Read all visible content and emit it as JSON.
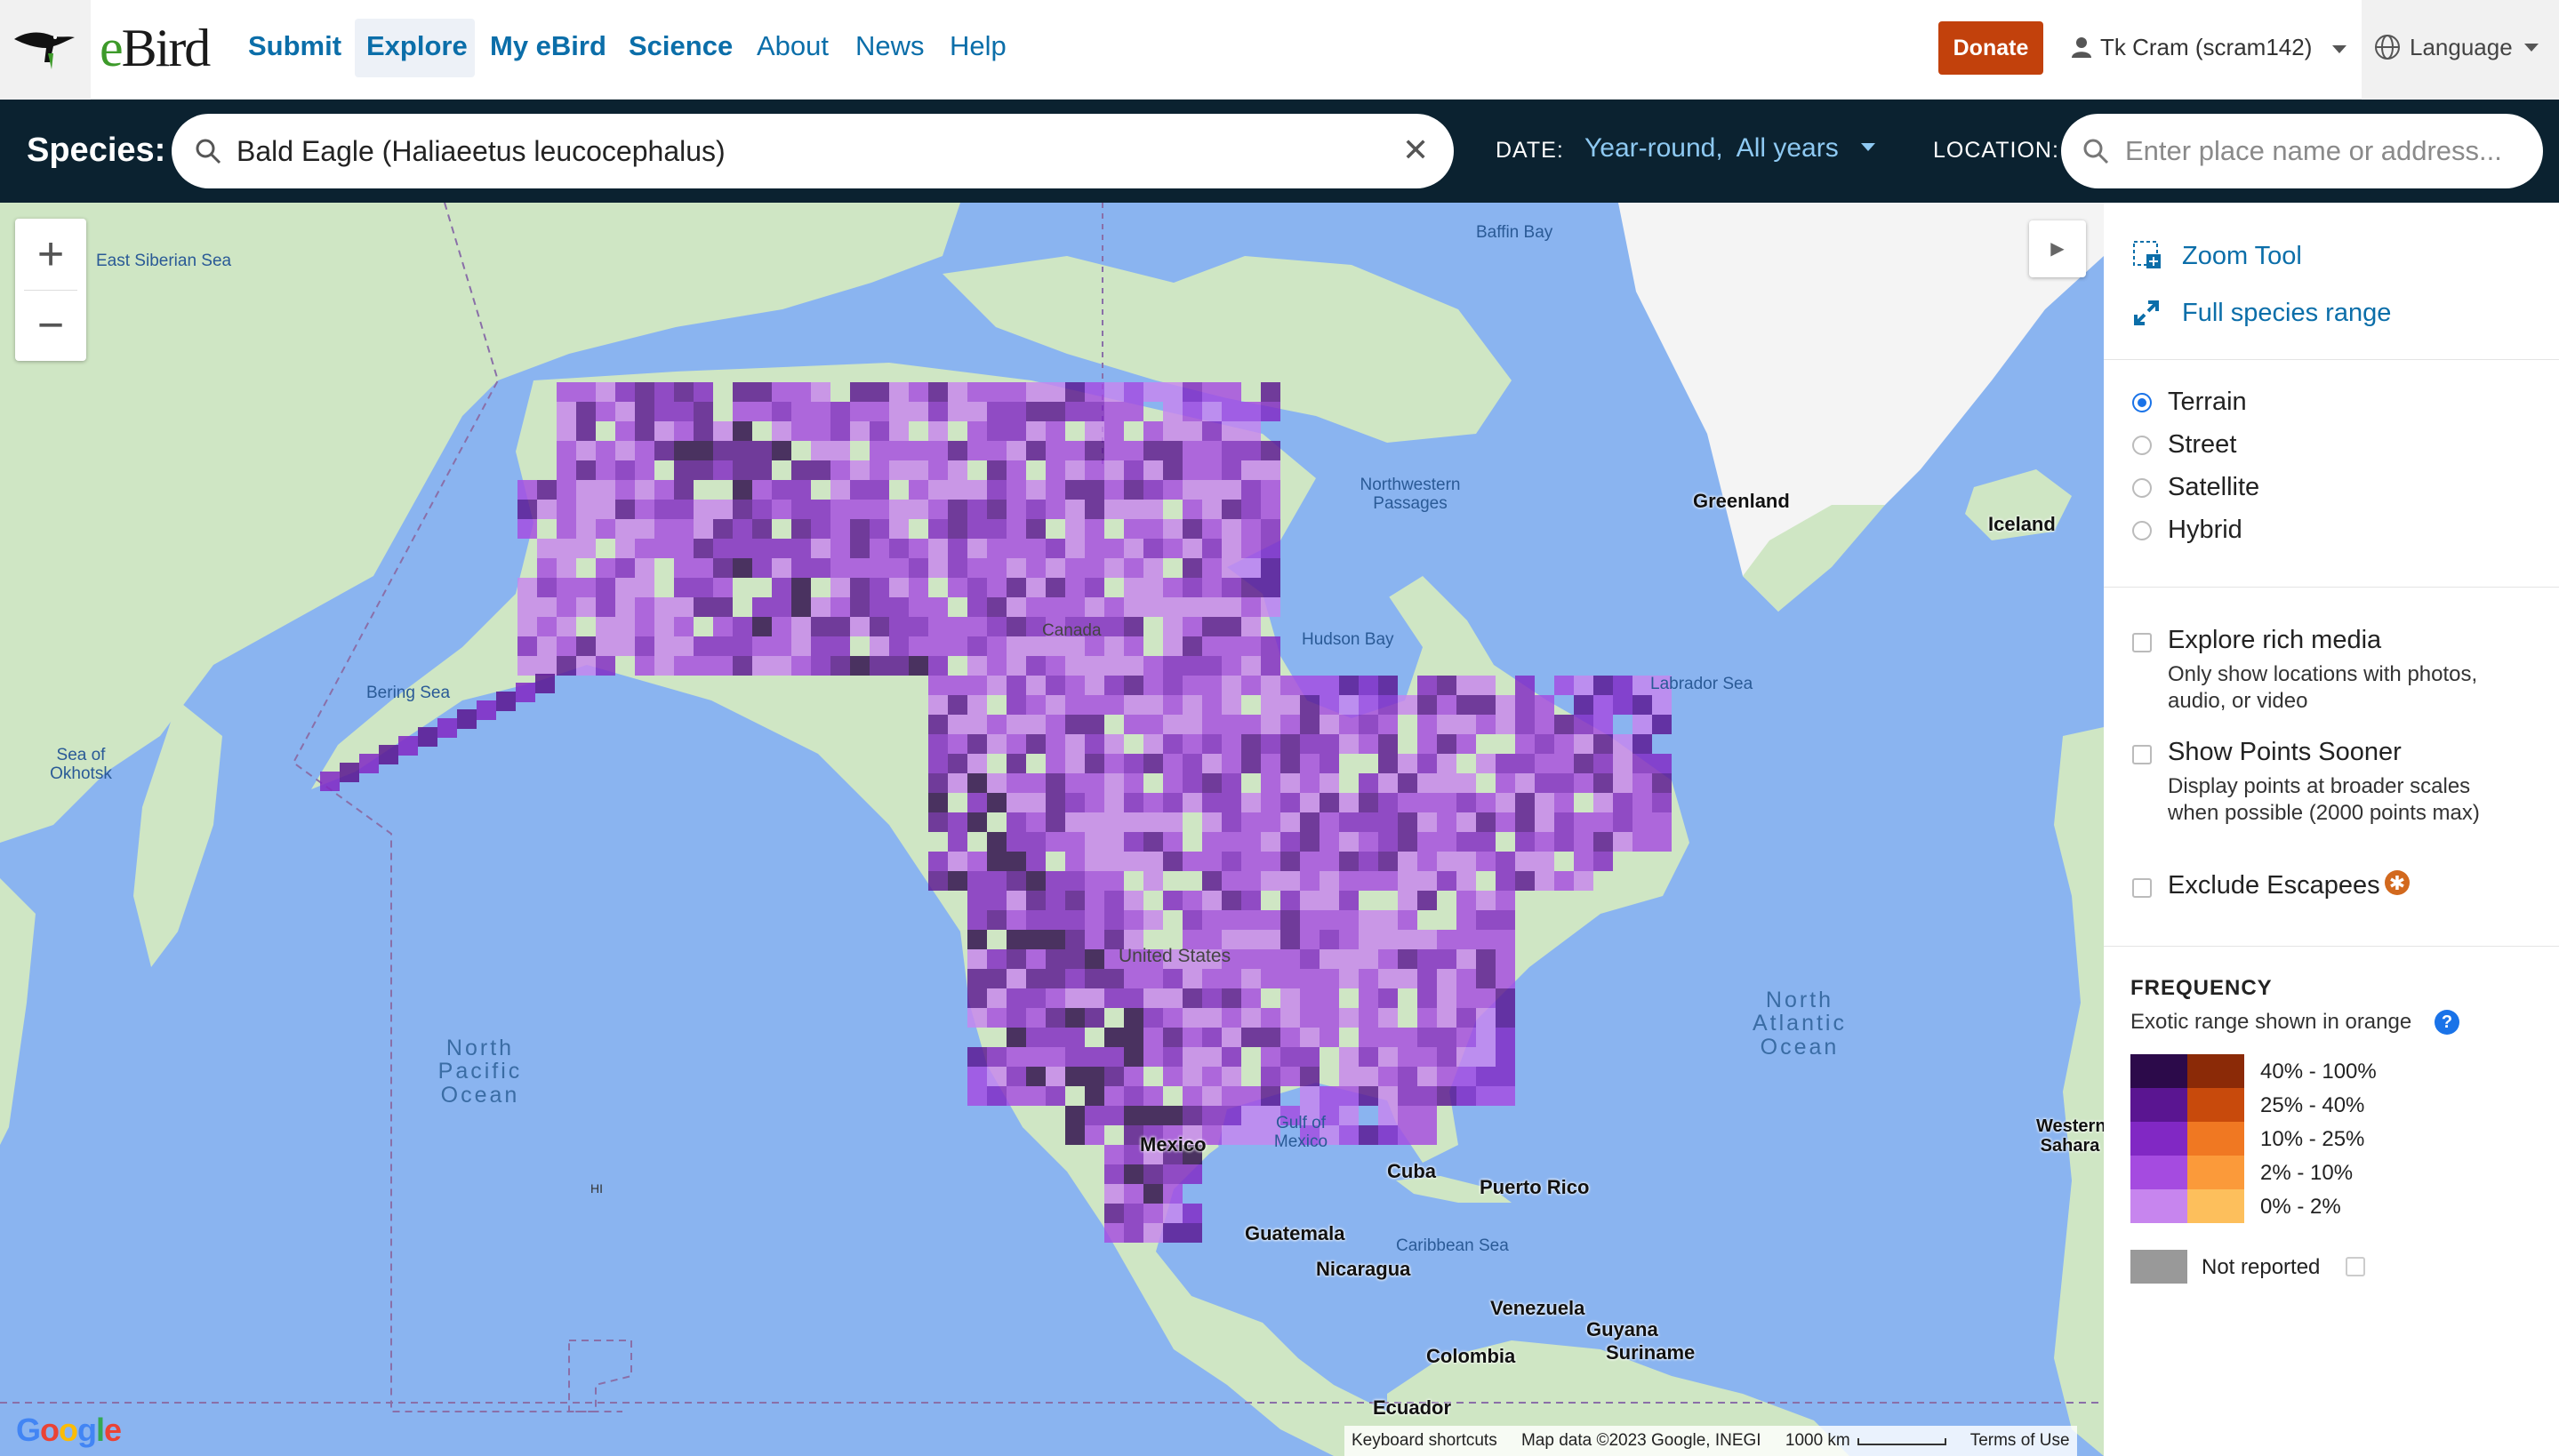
{
  "nav": {
    "brand": "eBird",
    "links": [
      "Submit",
      "Explore",
      "My eBird",
      "Science",
      "About",
      "News",
      "Help"
    ],
    "active": "Explore",
    "donate": "Donate",
    "user": "Tk Cram (scram142)",
    "language": "Language"
  },
  "search": {
    "species_label": "Species:",
    "species_value": "Bald Eagle (Haliaeetus leucocephalus)",
    "clear_icon": "close-icon",
    "date_label": "DATE:",
    "date_value": "Year-round,  All years",
    "location_label": "LOCATION:",
    "location_placeholder": "Enter place name or address..."
  },
  "map": {
    "labels": {
      "east_siberian_sea": "East Siberian Sea",
      "baffin_bay": "Baffin Bay",
      "northwestern_passages": "Northwestern Passages",
      "greenland": "Greenland",
      "iceland": "Iceland",
      "bering_sea": "Bering Sea",
      "sea_of_okhotsk": "Sea of Okhotsk",
      "hudson_bay": "Hudson Bay",
      "labrador_sea": "Labrador Sea",
      "canada": "Canada",
      "united_states": "United States",
      "north_pacific_ocean": "North Pacific Ocean",
      "north_atlantic_ocean": "North Atlantic Ocean",
      "gulf_of_mexico": "Gulf of Mexico",
      "mexico": "Mexico",
      "cuba": "Cuba",
      "puerto_rico": "Puerto Rico",
      "guatemala": "Guatemala",
      "nicaragua": "Nicaragua",
      "caribbean_sea": "Caribbean Sea",
      "venezuela": "Venezuela",
      "guyana": "Guyana",
      "suriname": "Suriname",
      "colombia": "Colombia",
      "ecuador": "Ecuador",
      "western_sahara": "Western Sahara",
      "hi": "HI"
    },
    "zoom_in": "+",
    "zoom_out": "−",
    "attribution": {
      "shortcuts": "Keyboard shortcuts",
      "map_data": "Map data ©2023 Google, INEGI",
      "scale": "1000 km",
      "terms": "Terms of Use"
    },
    "google": "Google",
    "colors": {
      "water": "#8ab4f0",
      "land": "#cfe6c4",
      "ice": "#f4f4f4"
    }
  },
  "panel": {
    "zoom_tool": "Zoom Tool",
    "full_range": "Full species range",
    "map_types": [
      "Terrain",
      "Street",
      "Satellite",
      "Hybrid"
    ],
    "selected_map_type": "Terrain",
    "options": [
      {
        "label": "Explore rich media",
        "desc": "Only show locations with photos, audio, or video",
        "checked": false
      },
      {
        "label": "Show Points Sooner",
        "desc": "Display points at broader scales when possible (2000 points max)",
        "checked": false
      },
      {
        "label": "Exclude Escapees",
        "desc": "",
        "checked": false
      }
    ],
    "frequency": {
      "title": "FREQUENCY",
      "subtitle": "Exotic range shown in orange",
      "bins": [
        {
          "label": "40% - 100%",
          "purple": "#2c0a4a",
          "orange": "#8b2a07"
        },
        {
          "label": "25% - 40%",
          "purple": "#5a1591",
          "orange": "#c84a0c"
        },
        {
          "label": "10% - 25%",
          "purple": "#8128c4",
          "orange": "#f07822"
        },
        {
          "label": "2% - 10%",
          "purple": "#a54be0",
          "orange": "#fb9a3a"
        },
        {
          "label": "0% - 2%",
          "purple": "#c785ee",
          "orange": "#fdbf5c"
        }
      ],
      "not_reported": "Not reported",
      "not_reported_color": "#999999"
    }
  }
}
